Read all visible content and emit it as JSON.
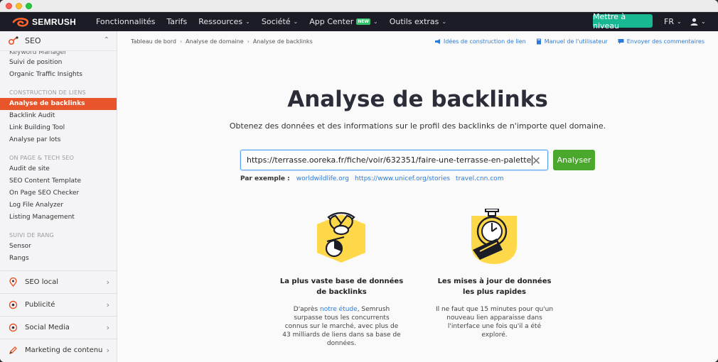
{
  "brand": {
    "name": "SEMRUSH",
    "accent": "#ff642d"
  },
  "nav": {
    "items": [
      {
        "label": "Fonctionnalités",
        "has_chevron": false
      },
      {
        "label": "Tarifs",
        "has_chevron": false
      },
      {
        "label": "Ressources",
        "has_chevron": true
      },
      {
        "label": "Société",
        "has_chevron": true
      },
      {
        "label": "App Center",
        "has_chevron": true,
        "badge": "NEW"
      },
      {
        "label": "Outils extras",
        "has_chevron": true
      }
    ],
    "upgrade_label": "Mettre à niveau",
    "language": "FR"
  },
  "sidebar": {
    "header": "SEO",
    "items_top": [
      {
        "label": "Keyword Manager"
      },
      {
        "label": "Suivi de position"
      },
      {
        "label": "Organic Traffic Insights"
      }
    ],
    "sections": [
      {
        "title": "CONSTRUCTION DE LIENS",
        "items": [
          {
            "label": "Analyse de backlinks",
            "active": true
          },
          {
            "label": "Backlink Audit"
          },
          {
            "label": "Link Building Tool"
          },
          {
            "label": "Analyse par lots"
          }
        ]
      },
      {
        "title": "ON PAGE & TECH SEO",
        "items": [
          {
            "label": "Audit de site"
          },
          {
            "label": "SEO Content Template"
          },
          {
            "label": "On Page SEO Checker"
          },
          {
            "label": "Log File Analyzer"
          },
          {
            "label": "Listing Management"
          }
        ]
      },
      {
        "title": "SUIVI DE RANG",
        "items": [
          {
            "label": "Sensor"
          },
          {
            "label": "Rangs"
          }
        ]
      }
    ],
    "groups": [
      {
        "label": "SEO local",
        "icon": "map-pin-icon"
      },
      {
        "label": "Publicité",
        "icon": "target-icon"
      },
      {
        "label": "Social Media",
        "icon": "social-icon"
      },
      {
        "label": "Marketing de contenu",
        "icon": "pencil-icon"
      }
    ]
  },
  "breadcrumb": [
    "Tableau de bord",
    "Analyse de domaine",
    "Analyse de backlinks"
  ],
  "toplinks": [
    {
      "label": "Idées de construction de lien",
      "icon": "megaphone-icon"
    },
    {
      "label": "Manuel de l'utilisateur",
      "icon": "book-icon"
    },
    {
      "label": "Envoyer des commentaires",
      "icon": "chat-icon"
    }
  ],
  "main": {
    "title": "Analyse de backlinks",
    "subtitle": "Obtenez des données et des informations sur le profil des backlinks de n'importe quel domaine.",
    "search_value": "https://terrasse.ooreka.fr/fiche/voir/632351/faire-une-terrasse-en-palette",
    "analyze_label": "Analyser",
    "examples_label": "Par exemple :",
    "examples": [
      "worldwildlife.org",
      "https://www.unicef.org/stories",
      "travel.cnn.com"
    ]
  },
  "features": [
    {
      "title_line1": "La plus vaste base de données",
      "title_line2": "de backlinks",
      "desc_pre": "D'après",
      "desc_link": "notre étude",
      "desc_post": ", Semrush",
      "desc_lines": [
        "surpasse tous les concurrents",
        "connus sur le marché, avec plus de",
        "43 milliards de liens dans sa base de",
        "données."
      ]
    },
    {
      "title_line1": "Les mises à jour de données",
      "title_line2": "les plus rapides",
      "desc_lines": [
        "Il ne faut que 15 minutes pour qu'un",
        "nouveau lien apparaisse dans",
        "l'interface une fois qu'il a été",
        "exploré."
      ]
    }
  ],
  "colors": {
    "yellow": "#ffd84a",
    "active_orange": "#e8552a",
    "analyze_green": "#4aa82c",
    "upgrade_teal": "#17b892"
  }
}
